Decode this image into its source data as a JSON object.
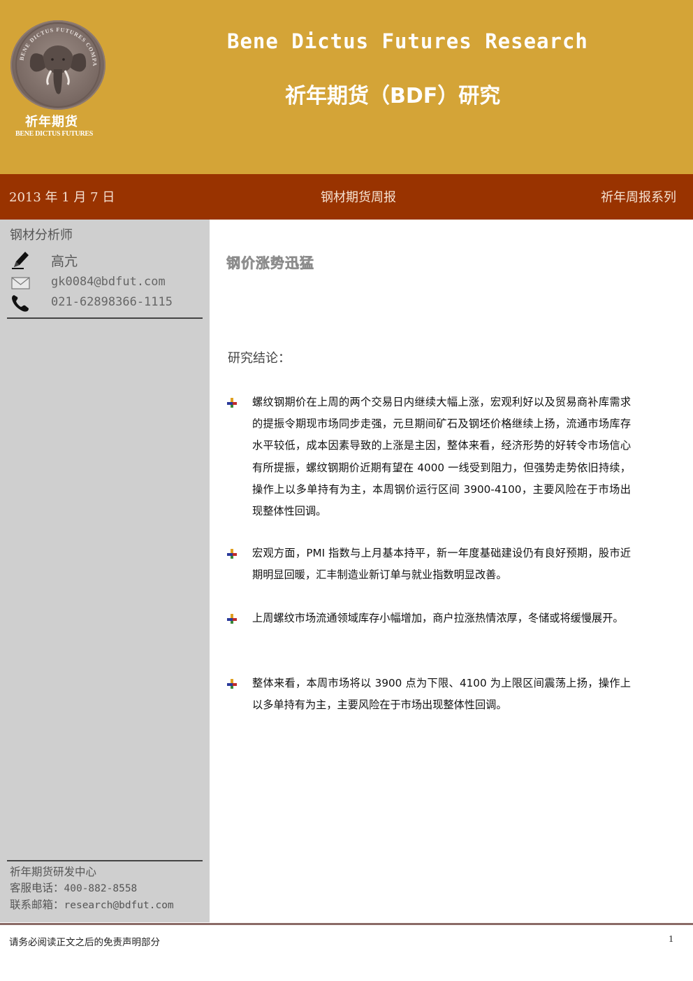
{
  "header": {
    "logo_ring_text": "BENE DICTUS FUTURES COMPANY LIMITED",
    "logo_cn": "祈年期货",
    "logo_en": "BENE DICTUS FUTURES",
    "title_en": "Bene Dictus Futures Research",
    "title_cn": "祈年期货（BDF）研究"
  },
  "datebar": {
    "date": "2013 年 1 月 7 日",
    "report_name": "钢材期货周报",
    "series": "祈年周报系列",
    "color": "#993300"
  },
  "sidebar": {
    "section_title": "钢材分析师",
    "analyst_name": "高亢",
    "email": "gk0084@bdfut.com",
    "phone": "021-62898366-1115",
    "footer": {
      "org": "祈年期货研发中心",
      "hotline_label": "客服电话：",
      "hotline": "400-882-8558",
      "mail_label": "联系邮箱：",
      "mail": "research@bdfut.com"
    }
  },
  "main": {
    "headline": "钢价涨势迅猛",
    "conclusion_title": "研究结论：",
    "bullets": [
      "螺纹钢期价在上周的两个交易日内继续大幅上涨，宏观利好以及贸易商补库需求的提振令期现市场同步走强，元旦期间矿石及钢坯价格继续上扬，流通市场库存水平较低，成本因素导致的上涨是主因，整体来看，经济形势的好转令市场信心有所提振，螺纹钢期价近期有望在 4000 一线受到阻力，但强势走势依旧持续，操作上以多单持有为主，本周钢价运行区间 3900-4100，主要风险在于市场出现整体性回调。",
      "宏观方面，PMI 指数与上月基本持平，新一年度基础建设仍有良好预期，股市近期明显回暖，汇丰制造业新订单与就业指数明显改善。",
      "上周螺纹市场流通领域库存小幅增加，商户拉涨热情浓厚，冬储或将缓慢展开。",
      "整体来看，本周市场将以 3900 点为下限、4100 为上限区间震荡上扬，操作上以多单持有为主，主要风险在于市场出现整体性回调。"
    ]
  },
  "footer": {
    "disclaimer": "请务必阅读正文之后的免责声明部分",
    "page": "1"
  },
  "icons": [
    "elephant-logo-icon",
    "pencil-icon",
    "envelope-icon",
    "phone-icon",
    "bullet-marker-icon"
  ]
}
